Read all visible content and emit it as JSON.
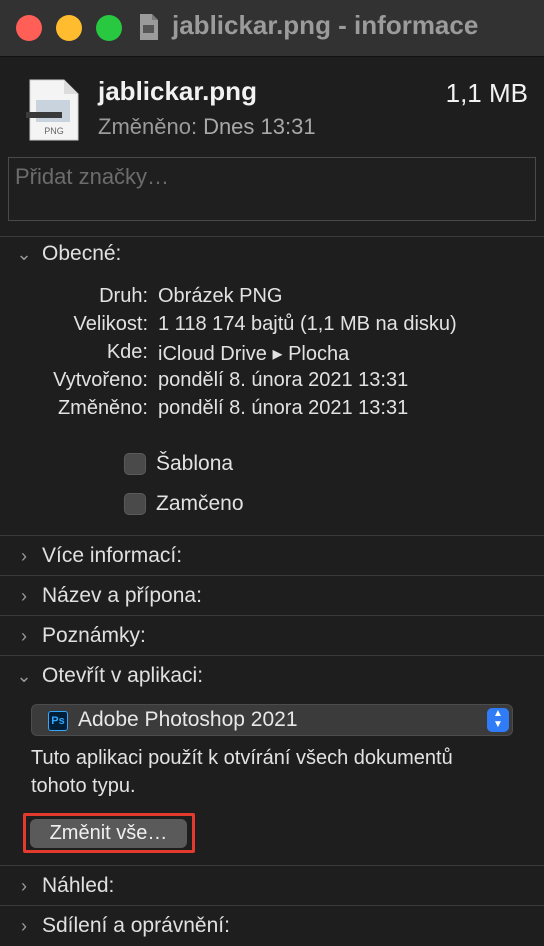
{
  "window": {
    "title": "jablickar.png - informace"
  },
  "file": {
    "name": "jablickar.png",
    "size": "1,1 MB",
    "modified_label": "Změněno:",
    "modified_value": "Dnes 13:31",
    "icon_badge": "PNG"
  },
  "tags": {
    "placeholder": "Přidat značky…"
  },
  "sections": {
    "general": "Obecné:",
    "more_info": "Více informací:",
    "name_ext": "Název a přípona:",
    "comments": "Poznámky:",
    "open_with": "Otevřít v aplikaci:",
    "preview": "Náhled:",
    "sharing": "Sdílení a oprávnění:"
  },
  "general": {
    "rows": [
      {
        "label": "Druh:",
        "value": "Obrázek PNG"
      },
      {
        "label": "Velikost:",
        "value": "1 118 174 bajtů (1,1 MB na disku)"
      },
      {
        "label": "Kde:",
        "value": "iCloud Drive ▸ Plocha"
      },
      {
        "label": "Vytvořeno:",
        "value": "pondělí 8. února 2021 13:31"
      },
      {
        "label": "Změněno:",
        "value": "pondělí 8. února 2021 13:31"
      }
    ],
    "stationery": "Šablona",
    "locked": "Zamčeno"
  },
  "open_with": {
    "app": "Adobe Photoshop 2021",
    "app_icon": "Ps",
    "help": "Tuto aplikaci použít k otvírání všech dokumentů tohoto typu.",
    "change_all": "Změnit vše…"
  },
  "colors": {
    "highlight": "#e23a2c",
    "accent": "#2f7cf6"
  }
}
